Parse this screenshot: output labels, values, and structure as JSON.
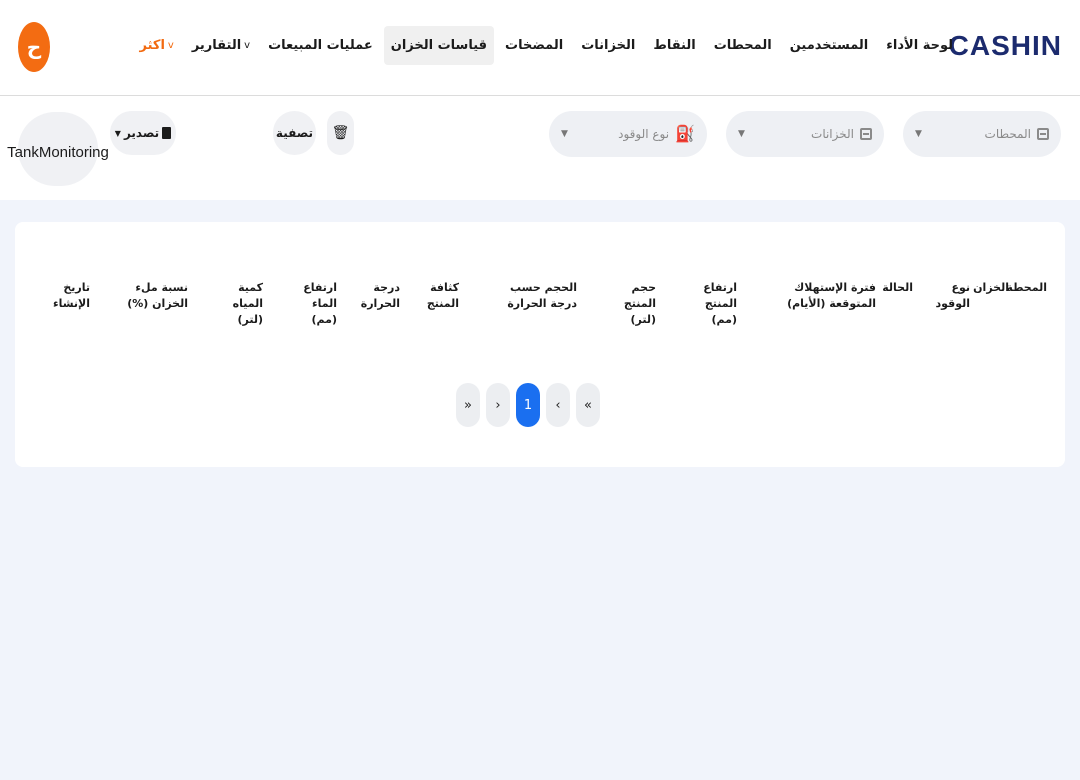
{
  "header": {
    "logo": "CASHIN",
    "nav": [
      {
        "label": "لوحة الأداء"
      },
      {
        "label": "المستخدمين"
      },
      {
        "label": "المحطات"
      },
      {
        "label": "النقاط"
      },
      {
        "label": "الخزانات"
      },
      {
        "label": "المضخات"
      },
      {
        "label": "قياسات الخزان",
        "active": true
      },
      {
        "label": "عمليات المبيعات"
      },
      {
        "label": "التقارير"
      },
      {
        "label": "اكثر"
      }
    ],
    "avatar_letter": "ح",
    "colors": {
      "brand": "#1c2b6e",
      "accent": "#f36c12",
      "active_page": "#1a6ff0"
    }
  },
  "filters": {
    "stations_placeholder": "المحطات",
    "tanks_placeholder": "الخزانات",
    "fuel_type_placeholder": "نوع الوقود",
    "filter_label": "تصفية",
    "export_label": "تصدير",
    "tank_monitoring_line1": "Tank",
    "tank_monitoring_line2": "Monitoring"
  },
  "table": {
    "columns": [
      "المحطة",
      "الخزان",
      "نوع الوقود",
      "الحالة",
      "فترة الإستهلاك المتوقعة (الأيام)",
      "ارتفاع المنتج (مم)",
      "حجم المنتج (لتر)",
      "الحجم حسب درجة الحرارة",
      "كثافة المنتج",
      "درجة الحرارة",
      "ارتفاع الماء (مم)",
      "كمية المياه (لتر)",
      "نسبة ملء الخزان (%)",
      "تاريخ الإنشاء"
    ],
    "rows": []
  },
  "pagination": {
    "first": "«",
    "prev": "‹",
    "current": "1",
    "next": "›",
    "last": "»"
  }
}
